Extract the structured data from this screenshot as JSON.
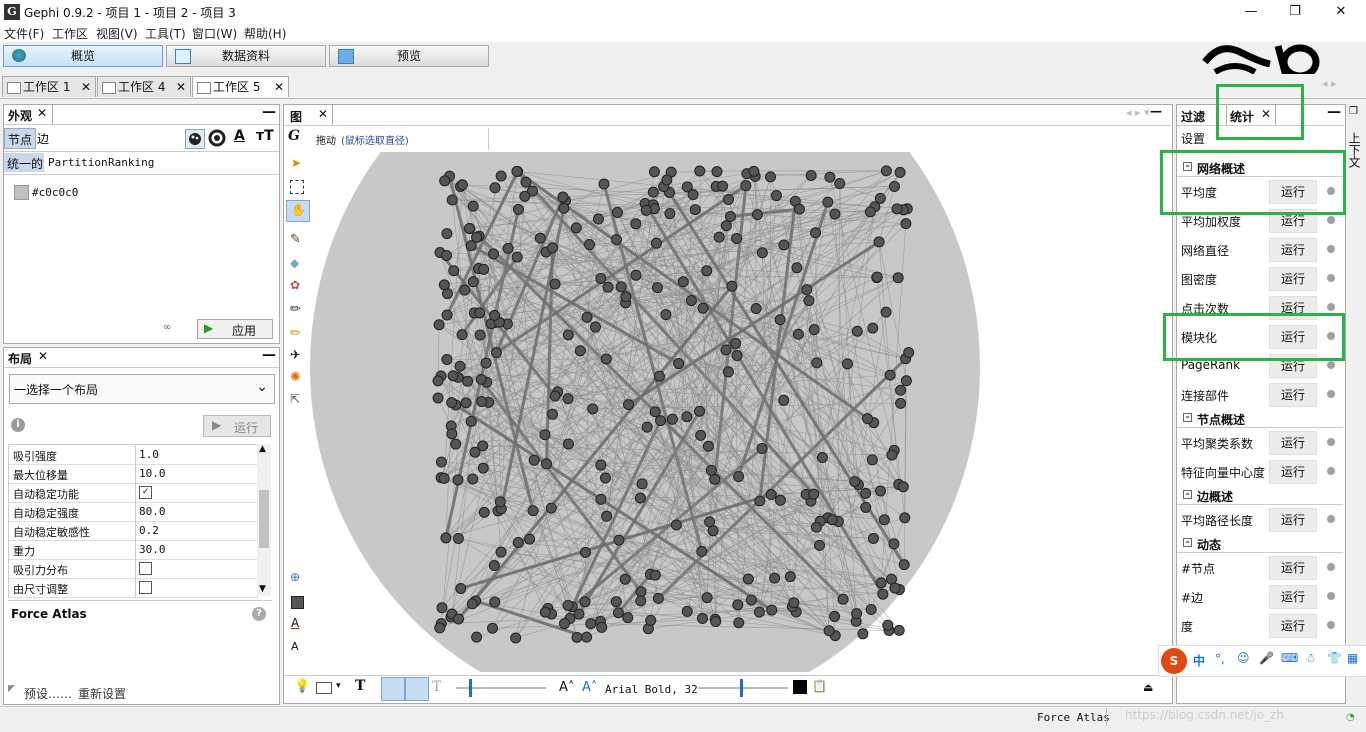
{
  "window": {
    "title": "Gephi 0.9.2 - 项目 1 - 项目 2 - 项目 3",
    "controls": [
      "—",
      "❐",
      "✕"
    ]
  },
  "menu": [
    "文件(F)",
    "工作区",
    "视图(V)",
    "工具(T)",
    "窗口(W)",
    "帮助(H)"
  ],
  "modes": [
    "概览",
    "数据资料",
    "预览"
  ],
  "workspaces": [
    "工作区 1",
    "工作区 4",
    "工作区 5"
  ],
  "appearance": {
    "tab": "外观",
    "subtabs": [
      "节点",
      "边"
    ],
    "modes": [
      "统一的",
      "Partition",
      "Ranking"
    ],
    "color_value": "#c0c0c0",
    "apply": "应用"
  },
  "layout": {
    "tab": "布局",
    "select": "一选择一个布局",
    "run": "运行",
    "params": [
      {
        "k": "吸引强度",
        "v": "1.0"
      },
      {
        "k": "最大位移量",
        "v": "10.0"
      },
      {
        "k": "自动稳定功能",
        "v": "checked"
      },
      {
        "k": "自动稳定强度",
        "v": "80.0"
      },
      {
        "k": "自动稳定敏感性",
        "v": "0.2"
      },
      {
        "k": "重力",
        "v": "30.0"
      },
      {
        "k": "吸引力分布",
        "v": "unchecked"
      },
      {
        "k": "由尺寸调整",
        "v": "unchecked"
      }
    ],
    "algo_name": "Force Atlas",
    "presets": "预设……",
    "reset": "重新设置"
  },
  "graph": {
    "tab": "图",
    "drag_label": "拖动",
    "drag_hint": "(鼠标选取直径)",
    "font_label": "Arial Bold, 32"
  },
  "right": {
    "tabs": [
      "过滤",
      "统计"
    ],
    "settings": "设置",
    "sections": [
      {
        "title": "网络概述",
        "items": [
          "平均度",
          "平均加权度",
          "网络直径",
          "图密度",
          "点击次数",
          "模块化",
          "PageRank",
          "连接部件"
        ]
      },
      {
        "title": "节点概述",
        "items": [
          "平均聚类系数",
          "特征向量中心度"
        ]
      },
      {
        "title": "边概述",
        "items": [
          "平均路径长度"
        ]
      },
      {
        "title": "动态",
        "items": [
          "#节点",
          "#边",
          "度"
        ]
      }
    ],
    "run_label": "运行",
    "side_label": "上下文"
  },
  "status": {
    "layout": "Force Atlas",
    "watermark": "https://blog.csdn.net/jo_zh"
  }
}
